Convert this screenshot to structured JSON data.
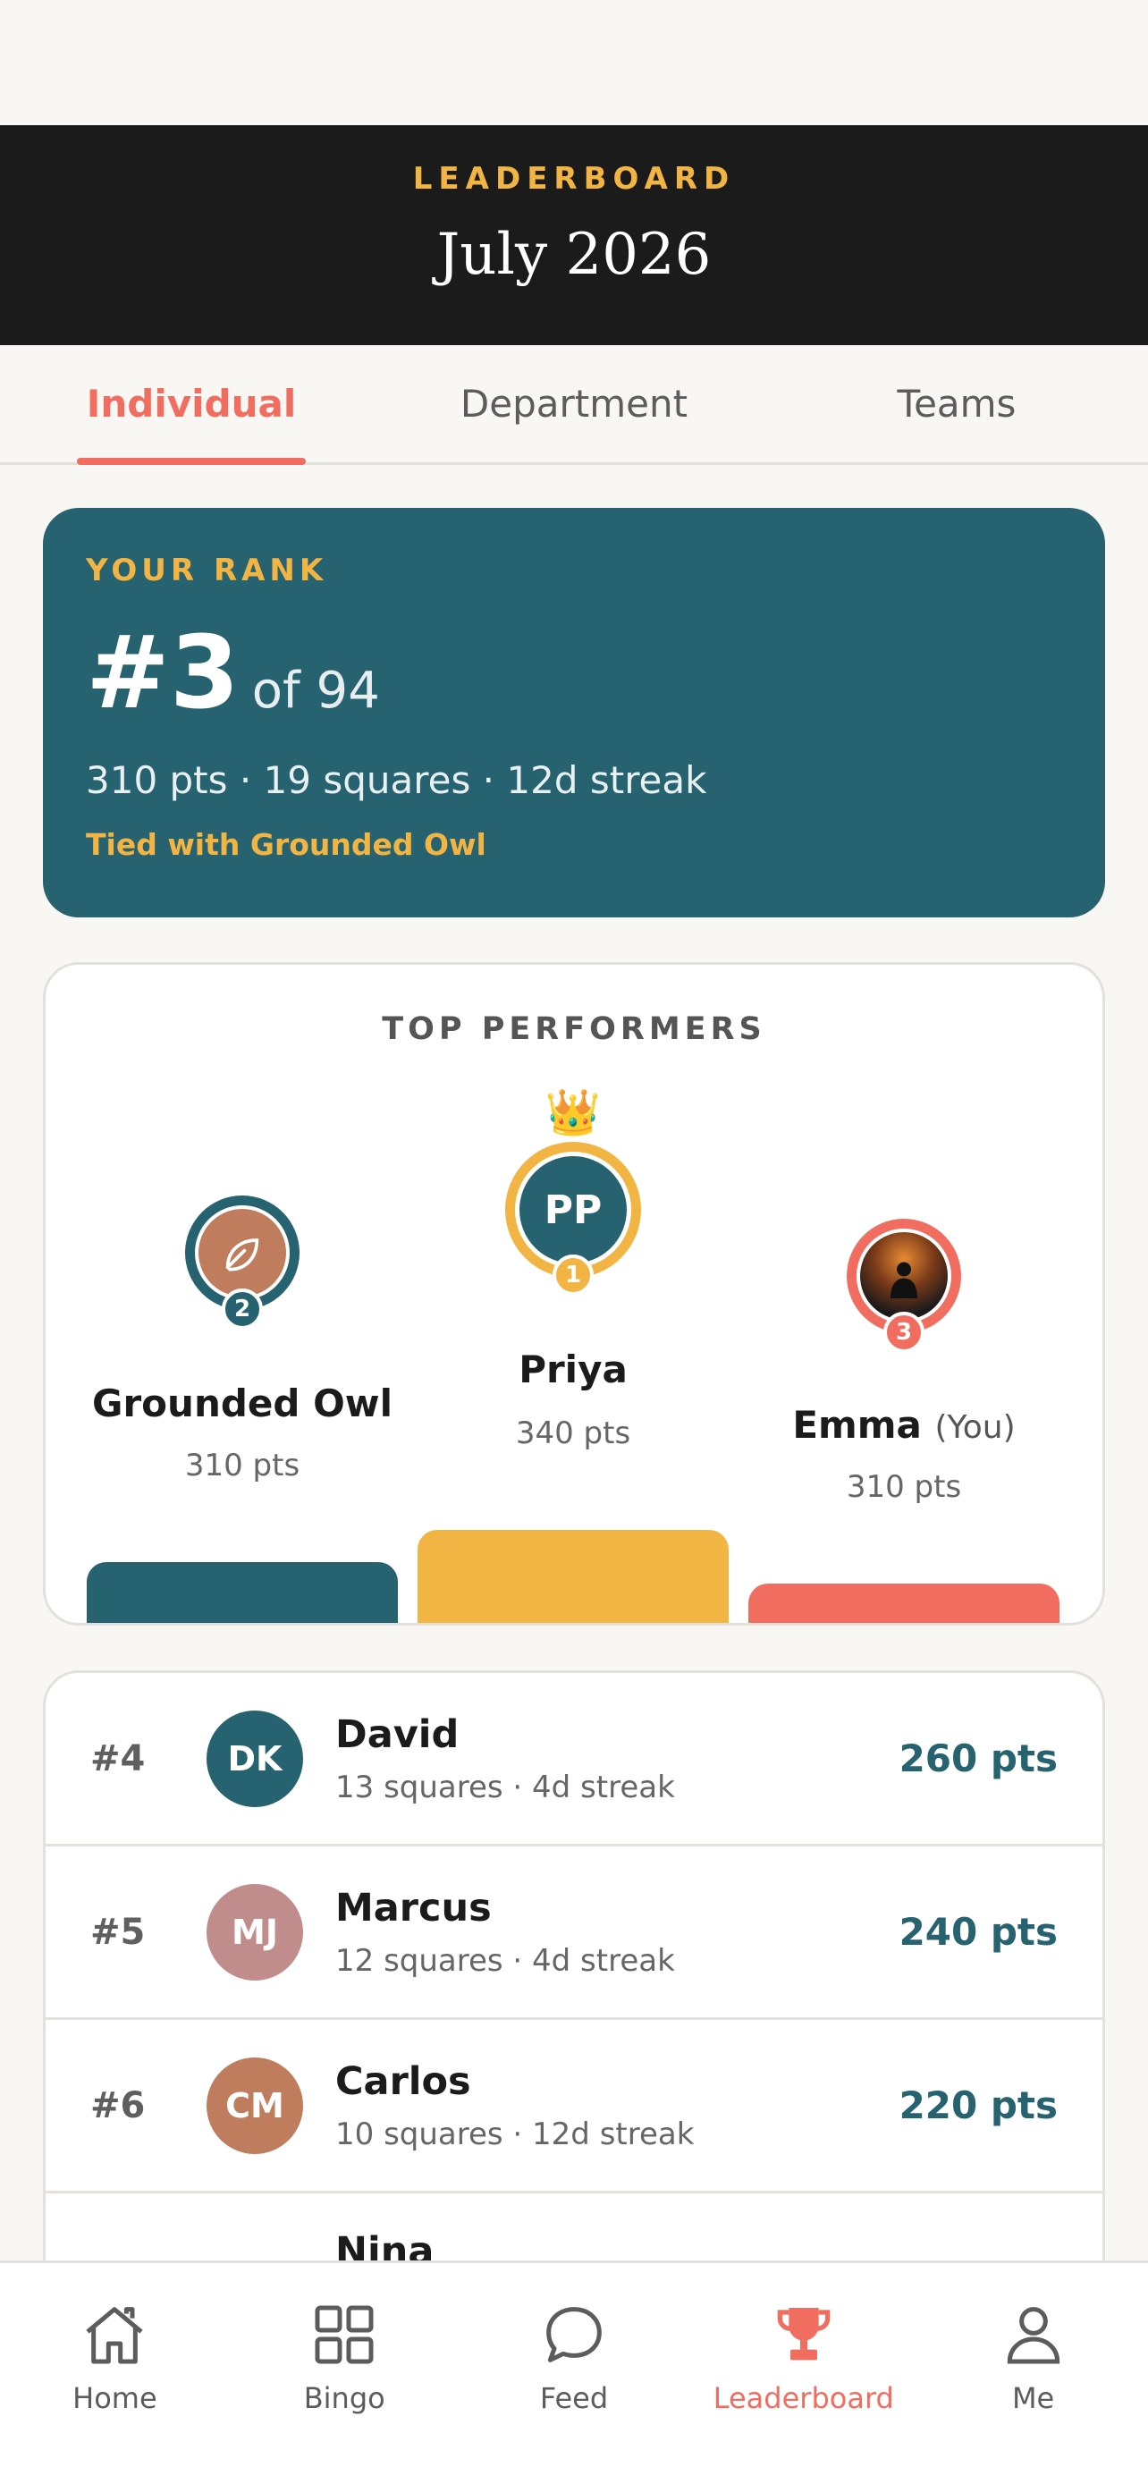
{
  "header": {
    "eyebrow": "LEADERBOARD",
    "title": "July 2026"
  },
  "tabs": [
    {
      "label": "Individual",
      "active": true
    },
    {
      "label": "Department",
      "active": false
    },
    {
      "label": "Teams",
      "active": false
    }
  ],
  "your_rank": {
    "label": "YOUR RANK",
    "rank": "#3",
    "of": "of 94",
    "stats": "310 pts · 19 squares · 12d streak",
    "tie": "Tied with Grounded Owl"
  },
  "top_performers": {
    "heading": "TOP PERFORMERS",
    "first": {
      "initials": "PP",
      "name": "Priya",
      "pts": "340 pts",
      "medal": "1",
      "crown": "👑"
    },
    "second": {
      "name": "Grounded Owl",
      "pts": "310 pts",
      "medal": "2",
      "icon": "leaf-icon"
    },
    "third": {
      "name": "Emma",
      "you": "(You)",
      "pts": "310 pts",
      "medal": "3",
      "icon": "photo-avatar"
    }
  },
  "list": [
    {
      "rank": "#4",
      "initials": "DK",
      "name": "David",
      "sub": "13 squares · 4d streak",
      "pts": "260 pts",
      "color": "#276270"
    },
    {
      "rank": "#5",
      "initials": "MJ",
      "name": "Marcus",
      "sub": "12 squares · 4d streak",
      "pts": "240 pts",
      "color": "#c08d8c"
    },
    {
      "rank": "#6",
      "initials": "CM",
      "name": "Carlos",
      "sub": "10 squares · 12d streak",
      "pts": "220 pts",
      "color": "#bf7d5d"
    },
    {
      "rank": "",
      "initials": "",
      "name": "Nina",
      "sub": "",
      "pts": "",
      "color": "#bf7d5d"
    }
  ],
  "nav": [
    {
      "label": "Home",
      "icon": "home-icon"
    },
    {
      "label": "Bingo",
      "icon": "grid-icon"
    },
    {
      "label": "Feed",
      "icon": "chat-icon"
    },
    {
      "label": "Leaderboard",
      "icon": "trophy-icon",
      "active": true
    },
    {
      "label": "Me",
      "icon": "user-icon"
    }
  ],
  "colors": {
    "accent": "#f06d5f",
    "teal": "#276270",
    "gold": "#f2b544"
  }
}
